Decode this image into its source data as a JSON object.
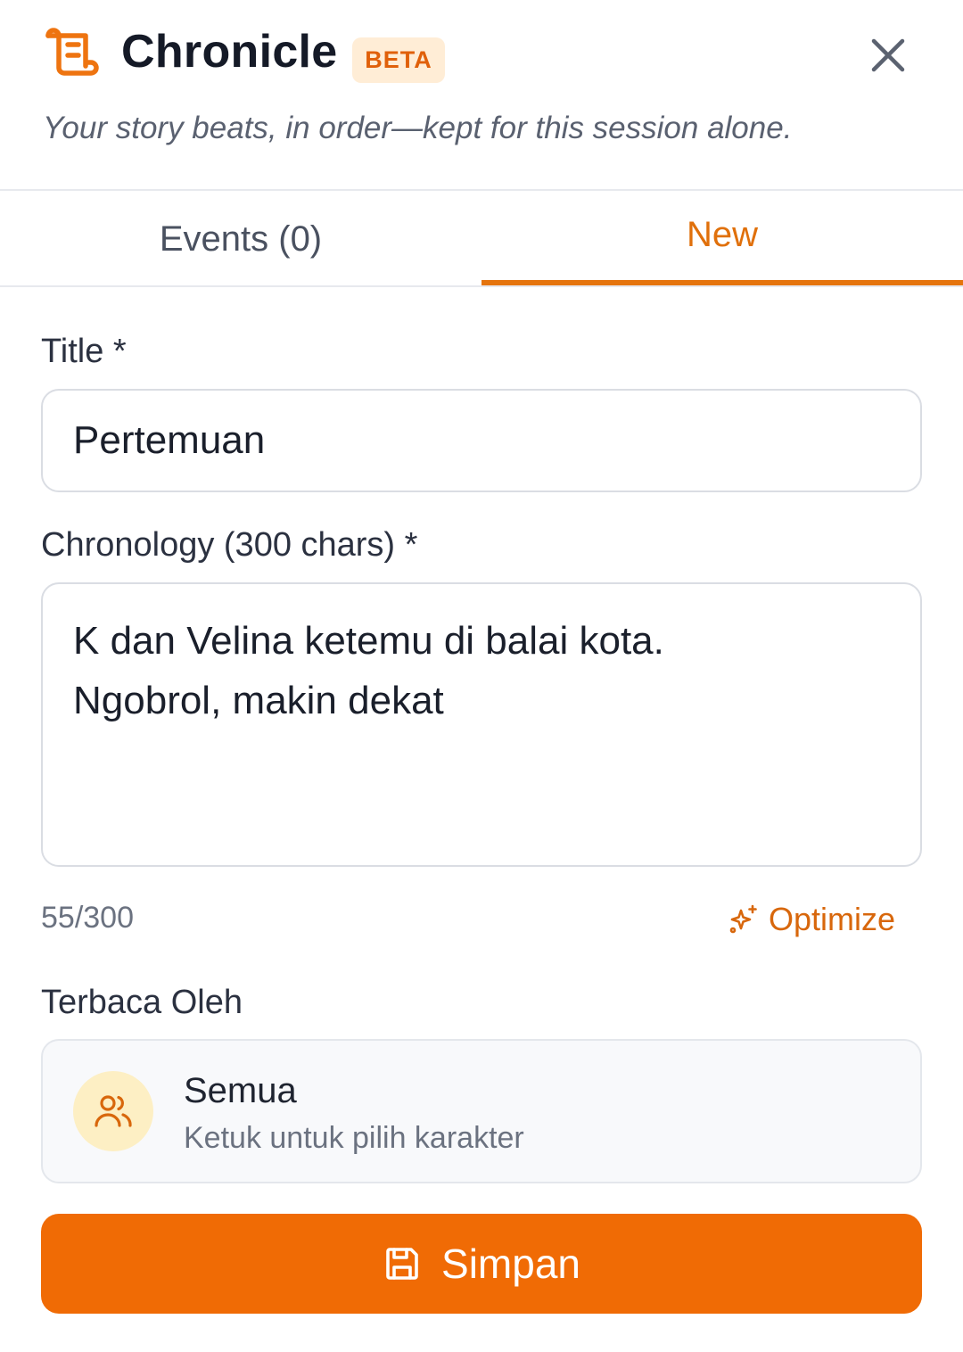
{
  "header": {
    "title": "Chronicle",
    "badge": "BETA",
    "subtitle": "Your story beats, in order—kept for this session alone.",
    "brand_icon": "scroll-icon",
    "close_icon": "close-icon"
  },
  "tabs": [
    {
      "label": "Events (0)",
      "active": false
    },
    {
      "label": "New",
      "active": true
    }
  ],
  "form": {
    "title_label": "Title *",
    "title_value": "Pertemuan",
    "chronology_label": "Chronology (300 chars) *",
    "chronology_value": "K dan Velina ketemu di balai kota.\nNgobrol, makin dekat",
    "char_count": "55/300",
    "optimize_label": "Optimize",
    "optimize_icon": "sparkles-icon",
    "reader_label": "Terbaca Oleh",
    "reader": {
      "name": "Semua",
      "hint": "Ketuk untuk pilih karakter",
      "icon": "users-icon"
    },
    "save_label": "Simpan",
    "save_icon": "save-icon"
  },
  "colors": {
    "accent": "#f06b05",
    "accent_text": "#e0700b",
    "badge_bg": "#ffedd6",
    "avatar_bg": "#fdefc4"
  }
}
